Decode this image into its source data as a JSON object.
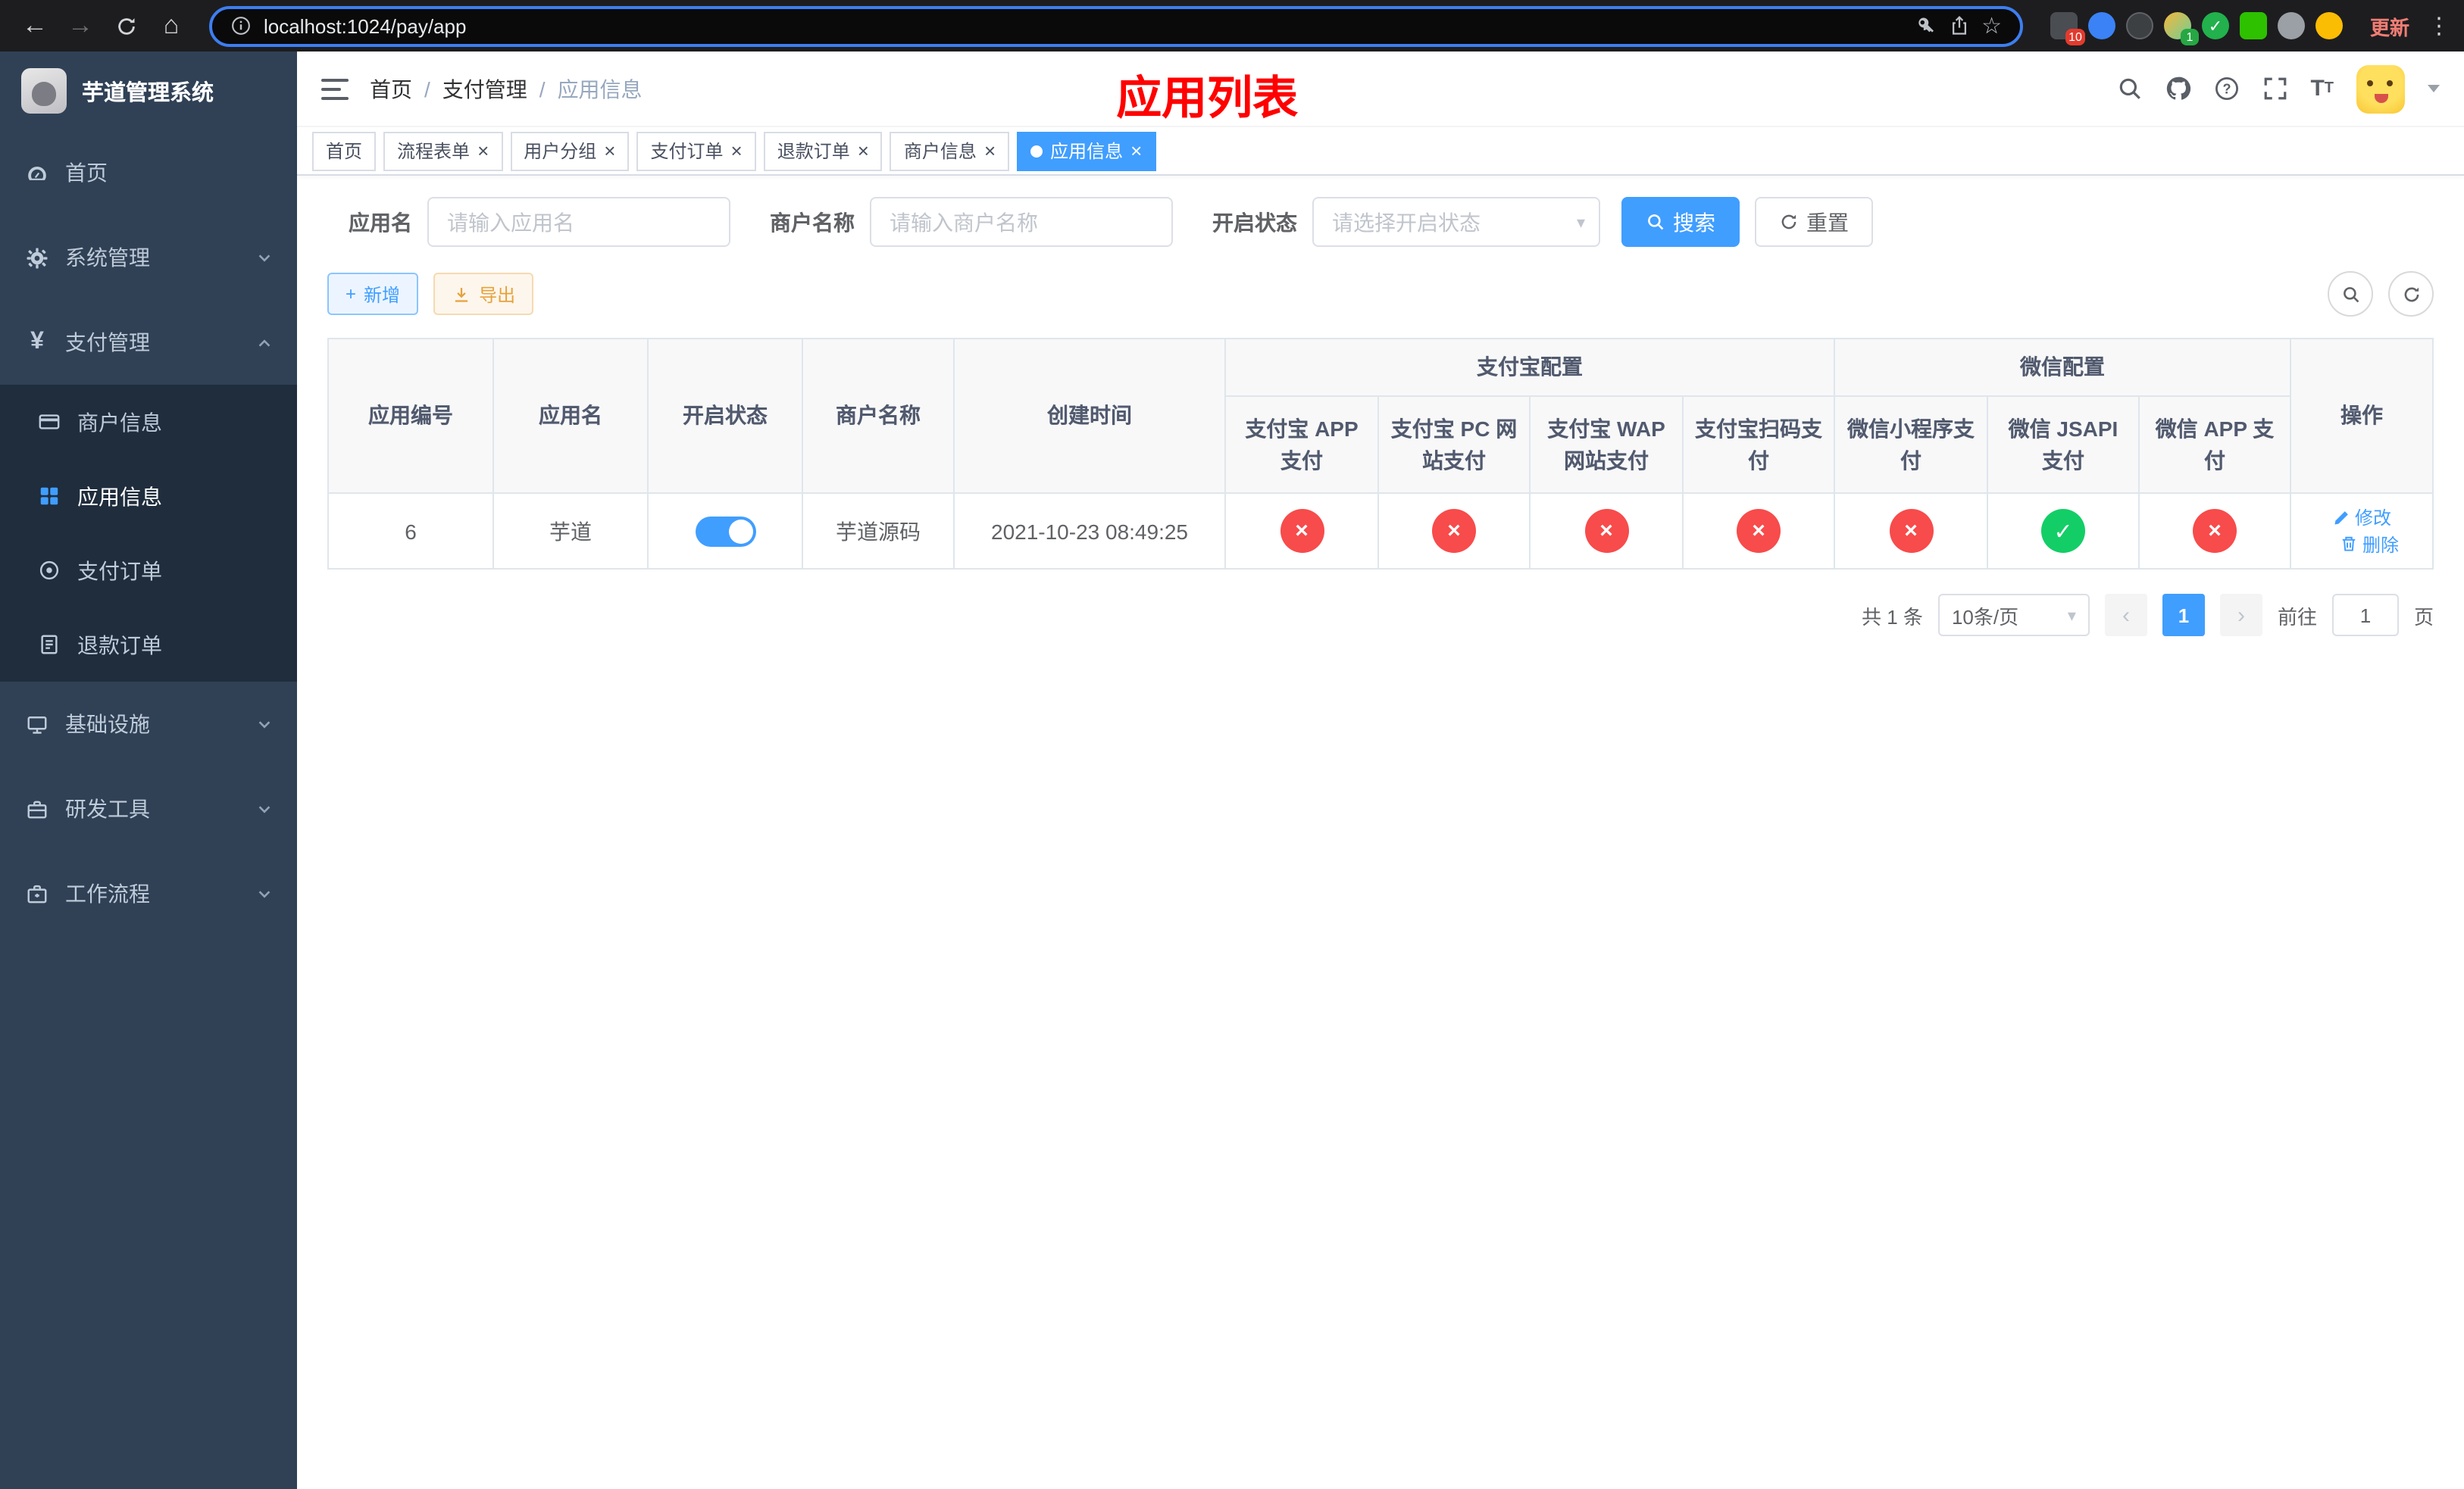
{
  "browser": {
    "url": "localhost:1024/pay/app",
    "update_label": "更新",
    "badges": {
      "red": "10",
      "green": "1"
    }
  },
  "sidebar": {
    "title": "芋道管理系统",
    "home": "首页",
    "system": "系统管理",
    "payment": "支付管理",
    "merchant_info": "商户信息",
    "app_info": "应用信息",
    "pay_order": "支付订单",
    "refund_order": "退款订单",
    "infra": "基础设施",
    "dev_tools": "研发工具",
    "workflow": "工作流程"
  },
  "header": {
    "breadcrumb": {
      "home": "首页",
      "section": "支付管理",
      "current": "应用信息"
    },
    "page_title": "应用列表"
  },
  "tabs": [
    {
      "label": "首页"
    },
    {
      "label": "流程表单"
    },
    {
      "label": "用户分组"
    },
    {
      "label": "支付订单"
    },
    {
      "label": "退款订单"
    },
    {
      "label": "商户信息"
    },
    {
      "label": "应用信息"
    }
  ],
  "filters": {
    "app_name_label": "应用名",
    "app_name_placeholder": "请输入应用名",
    "merchant_label": "商户名称",
    "merchant_placeholder": "请输入商户名称",
    "status_label": "开启状态",
    "status_placeholder": "请选择开启状态",
    "search_button": "搜索",
    "reset_button": "重置"
  },
  "toolbar": {
    "add_button": "新增",
    "export_button": "导出"
  },
  "table": {
    "groups": {
      "alipay": "支付宝配置",
      "wechat": "微信配置"
    },
    "columns": [
      "应用编号",
      "应用名",
      "开启状态",
      "商户名称",
      "创建时间",
      "支付宝 APP 支付",
      "支付宝 PC 网站支付",
      "支付宝 WAP 网站支付",
      "支付宝扫码支付",
      "微信小程序支付",
      "微信 JSAPI 支付",
      "微信 APP 支付",
      "操作"
    ],
    "row": {
      "id": "6",
      "name": "芋道",
      "status_on": true,
      "merchant": "芋道源码",
      "created_at": "2021-10-23 08:49:25",
      "pay_channels": [
        false,
        false,
        false,
        false,
        false,
        true,
        false
      ],
      "edit_label": "修改",
      "delete_label": "删除"
    }
  },
  "pagination": {
    "total": "共 1 条",
    "page_size": "10条/页",
    "page": "1",
    "goto_prefix": "前往",
    "goto_value": "1",
    "goto_suffix": "页"
  },
  "colors": {
    "accent": "#409EFF",
    "success": "#13ce66",
    "danger": "#f84b4b",
    "title_red": "#ff0000",
    "sidebar_bg": "#304156",
    "submenu_bg": "#1f2d3d"
  }
}
